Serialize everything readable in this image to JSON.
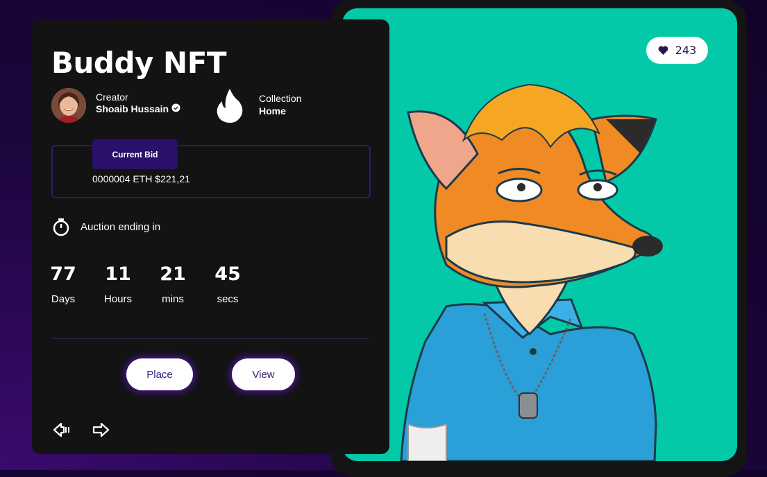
{
  "card": {
    "title": "Buddy NFT",
    "creator_label": "Creator",
    "creator_name": "Shoaib Hussain",
    "collection_label": "Collection",
    "collection_name": "Home",
    "bid_label": "Current Bid",
    "bid_value": "0000004 ETH $221,21",
    "auction_label": "Auction ending in",
    "countdown": [
      {
        "value": "77",
        "unit": "Days"
      },
      {
        "value": "11",
        "unit": "Hours"
      },
      {
        "value": "21",
        "unit": "mins"
      },
      {
        "value": "45",
        "unit": "secs"
      }
    ],
    "place_label": "Place",
    "view_label": "View",
    "icons": [
      "verified-badge-icon",
      "flame-icon",
      "timer-icon",
      "arrow-left-icon",
      "arrow-right-icon"
    ]
  },
  "artwork": {
    "likes": "243",
    "icon": "heart-icon",
    "background_color": "#03c9a9"
  },
  "colors": {
    "card_bg": "#131313",
    "accent": "#2a0f6b",
    "button_text": "#3a1d7a"
  }
}
